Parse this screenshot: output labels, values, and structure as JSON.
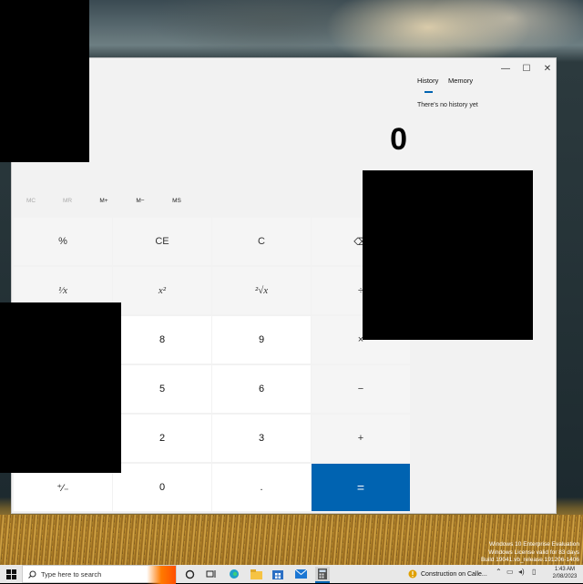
{
  "window": {
    "controls": {
      "minimize": "—",
      "maximize": "☐",
      "close": "✕"
    },
    "tabs": [
      {
        "label": "History",
        "active": true
      },
      {
        "label": "Memory",
        "active": false
      }
    ],
    "history_empty": "There's no history yet",
    "display_value": "0",
    "memory_buttons": [
      {
        "label": "MC",
        "enabled": false
      },
      {
        "label": "MR",
        "enabled": false
      },
      {
        "label": "M+",
        "enabled": true
      },
      {
        "label": "M−",
        "enabled": true
      },
      {
        "label": "MS",
        "enabled": true
      }
    ],
    "keys": {
      "percent": "%",
      "ce": "CE",
      "c": "C",
      "backspace": "⌫",
      "reciprocal": "¹⁄x",
      "square": "x²",
      "sqrt": "²√x",
      "divide": "÷",
      "eight": "8",
      "nine": "9",
      "multiply": "×",
      "five": "5",
      "six": "6",
      "minus": "−",
      "two": "2",
      "three": "3",
      "plus": "+",
      "negate": "⁺⁄₋",
      "zero": "0",
      "decimal": ".",
      "equals": "="
    },
    "accent_color": "#0063b1"
  },
  "watermark": {
    "line1": "Windows 10 Enterprise Evaluation",
    "line2": "Windows License valid for 83 days",
    "line3": "Build 19041.vb_release.191206-1406"
  },
  "taskbar": {
    "search_placeholder": "Type here to search",
    "notification_text": "Construction on Calle...",
    "clock_time": "1:43 AM",
    "clock_date": "2/08/2023",
    "icons": [
      "windows-start-icon",
      "search-icon",
      "cortana-icon",
      "task-view-icon",
      "edge-icon",
      "file-explorer-icon",
      "store-icon",
      "mail-icon",
      "calculator-icon",
      "warning-icon",
      "chevron-up-icon",
      "network-icon",
      "volume-icon",
      "notification-icon"
    ]
  }
}
